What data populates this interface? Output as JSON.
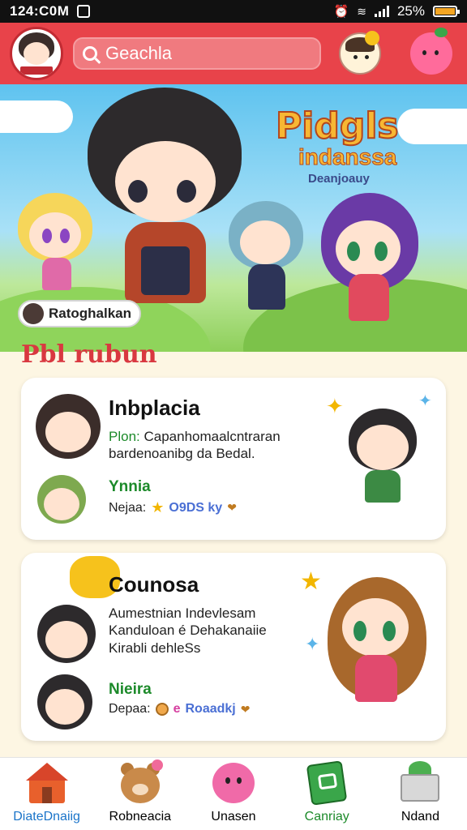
{
  "status_bar": {
    "time": "124:C0M",
    "battery": "25%"
  },
  "header": {
    "search_placeholder": "Geachla"
  },
  "hero": {
    "title": "Pidgls",
    "subtitle": "indanssa",
    "tagline": "Deanjoauy",
    "featured_user": "Ratoghalkan"
  },
  "section_title": "Pbl rubun",
  "cards": [
    {
      "title": "Inbplacia",
      "desc_prefix": "Plon: ",
      "desc_highlight": "Capanhomaalcntraran",
      "desc_rest": "bardenoanibg da Bedal.",
      "user_name": "Ynnia",
      "meta_label": "Nejaa:",
      "meta_tag": "O9DS ky"
    },
    {
      "title": "Counosa",
      "desc_lines": [
        "Aumestnian Indevlesam",
        "Kanduloan é Dehakanaiie",
        "Kirabli dehleSs"
      ],
      "user_name": "Nieira",
      "meta_label": "Depaa:",
      "meta_tag": "Roaadkj"
    }
  ],
  "nav": [
    {
      "label": "DiateDnaiig",
      "icon": "house-icon",
      "active": true
    },
    {
      "label": "Robneacia",
      "icon": "bear-icon",
      "active": false
    },
    {
      "label": "Unasen",
      "icon": "pink-blob-icon",
      "active": false
    },
    {
      "label": "Canriay",
      "icon": "green-book-icon",
      "active": false
    },
    {
      "label": "Ndand",
      "icon": "basket-icon",
      "active": false
    }
  ],
  "colors": {
    "header": "#e8434a",
    "accent_green": "#1c8a2a",
    "active_nav": "#1a74c9",
    "section_title": "#d93840"
  }
}
